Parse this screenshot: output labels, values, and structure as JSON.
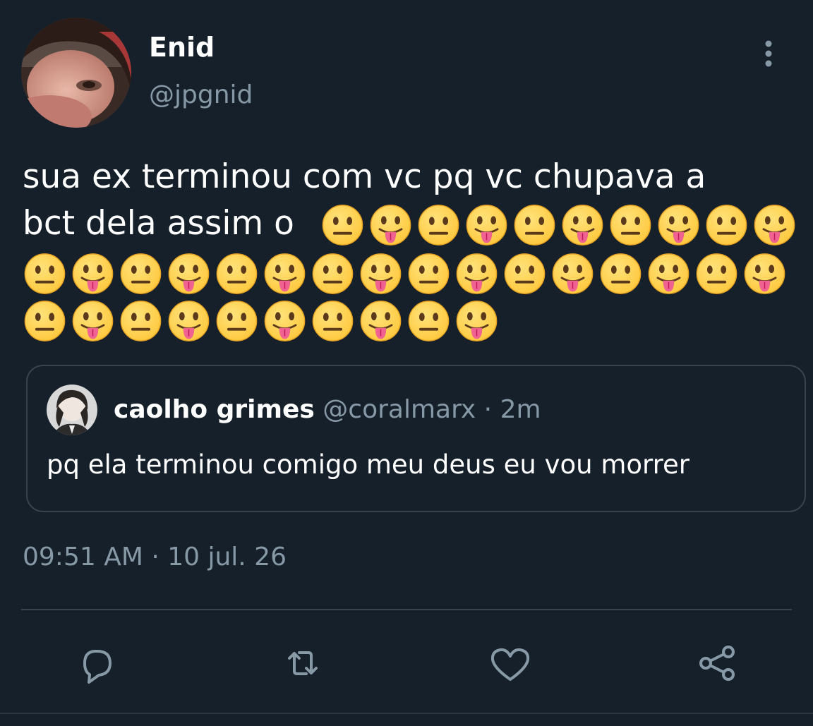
{
  "tweet": {
    "author": {
      "display_name": "Enid",
      "handle": "@jpgnid"
    },
    "text_line1": "sua ex terminou com vc pq vc chupava a",
    "text_line2": "bct dela assim o",
    "emoji_sequence": [
      "neutral-face",
      "face-with-tongue",
      "neutral-face",
      "face-with-tongue",
      "neutral-face",
      "face-with-tongue",
      "neutral-face",
      "face-with-tongue",
      "neutral-face",
      "face-with-tongue",
      "neutral-face",
      "face-with-tongue",
      "neutral-face",
      "face-with-tongue",
      "neutral-face",
      "face-with-tongue",
      "neutral-face",
      "face-with-tongue",
      "neutral-face",
      "face-with-tongue",
      "neutral-face",
      "face-with-tongue",
      "neutral-face",
      "face-with-tongue",
      "neutral-face",
      "face-with-tongue",
      "neutral-face",
      "face-with-tongue",
      "neutral-face",
      "face-with-tongue",
      "neutral-face",
      "face-with-tongue",
      "neutral-face",
      "face-with-tongue",
      "neutral-face",
      "face-with-tongue"
    ],
    "timestamp": "09:51 AM · 10 jul. 26"
  },
  "quoted_tweet": {
    "display_name": "caolho grimes",
    "handle": "@coralmarx",
    "separator": " · ",
    "time": "2m",
    "text": "pq ela terminou comigo meu deus eu vou morrer"
  },
  "icons": {
    "more": "more-vertical-icon",
    "reply": "reply-icon",
    "retweet": "retweet-icon",
    "like": "heart-icon",
    "share": "share-icon"
  },
  "colors": {
    "background": "#15202b",
    "secondary_text": "#8899a6",
    "border": "#38444d",
    "emoji_yellow": "#ffc83d",
    "tongue": "#f06292"
  }
}
